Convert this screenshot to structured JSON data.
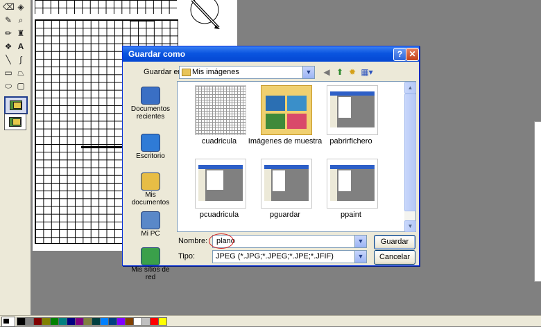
{
  "dialog": {
    "title": "Guardar como",
    "help_label": "?",
    "close_label": "✕",
    "save_in_label": "Guardar en:",
    "save_in_value": "Mis imágenes",
    "name_label": "Nombre:",
    "name_value": "plano",
    "type_label": "Tipo:",
    "type_value": "JPEG (*.JPG;*.JPEG;*.JPE;*.JFIF)",
    "save_button": "Guardar",
    "cancel_button": "Cancelar",
    "places": [
      {
        "label": "Documentos recientes",
        "icon": "recent-documents-icon"
      },
      {
        "label": "Escritorio",
        "icon": "desktop-icon"
      },
      {
        "label": "Mis documentos",
        "icon": "my-documents-icon"
      },
      {
        "label": "Mi PC",
        "icon": "my-computer-icon"
      },
      {
        "label": "Mis sitios de red",
        "icon": "network-places-icon"
      }
    ],
    "files": [
      {
        "name": "cuadricula"
      },
      {
        "name": "Imágenes de muestra"
      },
      {
        "name": "pabrirfichero"
      },
      {
        "name": "pcuadricula"
      },
      {
        "name": "pguardar"
      },
      {
        "name": "ppaint"
      }
    ]
  },
  "palette_colors": [
    "#000000",
    "#808080",
    "#800000",
    "#808000",
    "#008000",
    "#008080",
    "#000080",
    "#800080",
    "#808040",
    "#004040",
    "#0080ff",
    "#004080",
    "#8000ff",
    "#804000",
    "#ffffff",
    "#c0c0c0",
    "#ff0000",
    "#ffff00"
  ]
}
